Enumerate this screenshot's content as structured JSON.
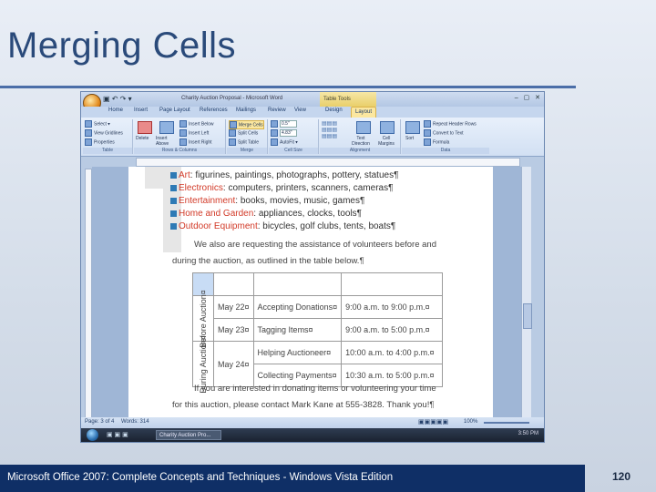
{
  "slide": {
    "title": "Merging Cells",
    "footer": "Microsoft Office 2007: Complete Concepts and Techniques - Windows Vista Edition",
    "page_number": "120"
  },
  "window": {
    "title": "Charity Auction Proposal - Microsoft Word",
    "context_tab": "Table Tools"
  },
  "tabs": [
    "Home",
    "Insert",
    "Page Layout",
    "References",
    "Mailings",
    "Review",
    "View",
    "Design",
    "Layout"
  ],
  "ribbon": {
    "table": {
      "select": "Select",
      "gridlines": "View Gridlines",
      "properties": "Properties",
      "label": "Table"
    },
    "rows_columns": {
      "delete": "Delete",
      "insert_above": "Insert Above",
      "insert_below": "Insert Below",
      "insert_left": "Insert Left",
      "insert_right": "Insert Right",
      "label": "Rows & Columns"
    },
    "merge": {
      "merge_cells": "Merge Cells",
      "split_cells": "Split Cells",
      "split_table": "Split Table",
      "label": "Merge"
    },
    "cell_size": {
      "height": "0.5\"",
      "width": "4.83\"",
      "autofit": "AutoFit",
      "label": "Cell Size"
    },
    "alignment": {
      "text_direction": "Text Direction",
      "cell_margins": "Cell Margins",
      "label": "Alignment"
    },
    "data": {
      "sort": "Sort",
      "repeat_header": "Repeat Header Rows",
      "convert": "Convert to Text",
      "formula": "Formula",
      "label": "Data"
    }
  },
  "document": {
    "bullets": [
      {
        "key": "Art",
        "rest": ": figurines, paintings, photographs, pottery, statues¶"
      },
      {
        "key": "Electronics",
        "rest": ": computers, printers, scanners, cameras¶"
      },
      {
        "key": "Entertainment",
        "rest": ": books, movies, music, games¶"
      },
      {
        "key": "Home and Garden",
        "rest": ": appliances, clocks, tools¶"
      },
      {
        "key": "Outdoor Equipment",
        "rest": ": bicycles, golf clubs, tents, boats¶"
      }
    ],
    "para1_line1": "We also are requesting the assistance of volunteers before and",
    "para1_line2": "during the auction, as outlined in the table below.¶",
    "table": {
      "before": "Before Auction¤",
      "during": "During Auction¤",
      "rows": [
        {
          "date": "May 22¤",
          "task": "Accepting Donations¤",
          "time": "9:00 a.m. to 9:00 p.m.¤"
        },
        {
          "date": "May 23¤",
          "task": "Tagging Items¤",
          "time": "9:00 a.m. to 5:00 p.m.¤"
        },
        {
          "date": "May 24¤",
          "task": "Helping Auctioneer¤",
          "time": "10:00 a.m. to 4:00 p.m.¤"
        },
        {
          "date": "",
          "task": "Collecting Payments¤",
          "time": "10:30 a.m. to 5:00 p.m.¤"
        }
      ]
    },
    "para2_line1": "If you are interested in donating items or volunteering your time",
    "para2_line2": "for this auction, please contact Mark Kane at 555-3828. Thank you!¶"
  },
  "status": {
    "page": "Page: 3 of 4",
    "words": "Words: 314",
    "zoom": "100%"
  },
  "taskbar": {
    "item": "Charity Auction Pro...",
    "clock": "3:50 PM"
  }
}
